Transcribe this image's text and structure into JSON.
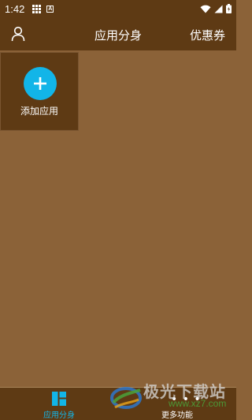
{
  "status_bar": {
    "time": "1:42",
    "icons": [
      "grid-app-icon",
      "a-notification-icon",
      "wifi-icon",
      "signal-icon",
      "battery-icon"
    ]
  },
  "header": {
    "title": "应用分身",
    "coupon_label": "优惠券",
    "user_icon": "user-icon"
  },
  "main": {
    "add_app_label": "添加应用",
    "add_icon": "plus-icon"
  },
  "bottom_nav": {
    "items": [
      {
        "label": "应用分身",
        "icon": "dashboard-icon",
        "active": true
      },
      {
        "label": "更多功能",
        "icon": "more-dots-icon",
        "active": false
      }
    ]
  },
  "watermark": {
    "text": "极光下载站",
    "url": "www.xz7.com"
  },
  "colors": {
    "background": "#8B6238",
    "bar": "#5E3A14",
    "accent": "#12B5E8"
  }
}
